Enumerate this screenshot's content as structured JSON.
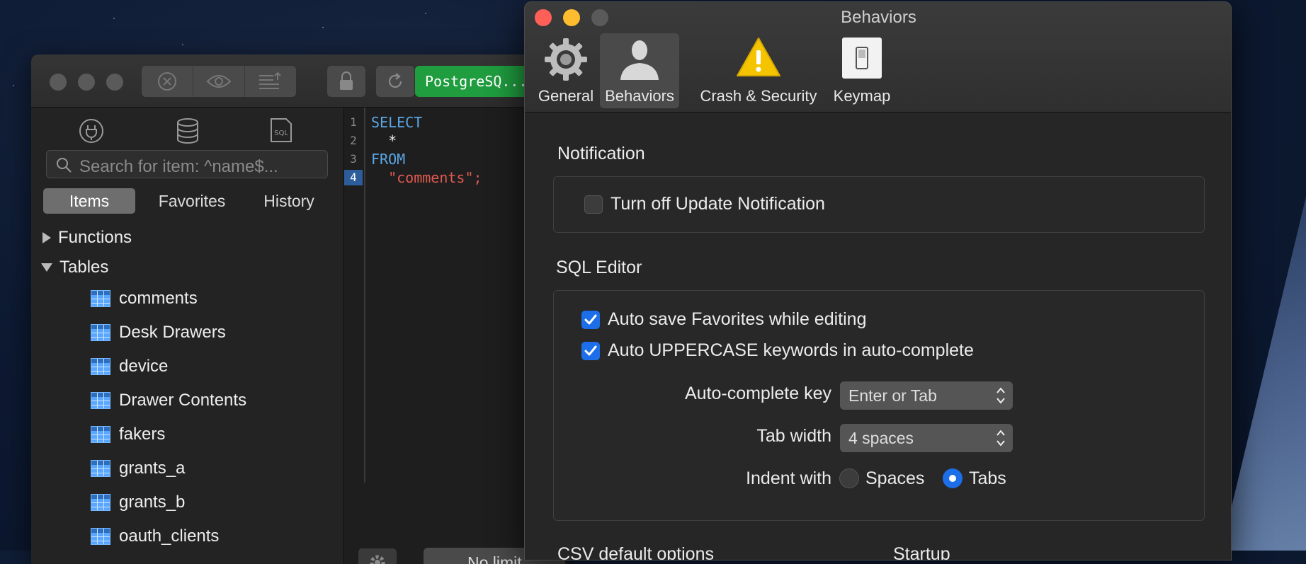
{
  "app": {
    "connection_badge": "PostgreSQ...",
    "search": {
      "placeholder": "Search for item: ^name$..."
    },
    "sidebar_tabs": [
      "Items",
      "Favorites",
      "History"
    ],
    "tree": {
      "functions_label": "Functions",
      "tables_label": "Tables",
      "tables": [
        "comments",
        "Desk Drawers",
        "device",
        "Drawer Contents",
        "fakers",
        "grants_a",
        "grants_b",
        "oauth_clients"
      ]
    },
    "editor": {
      "line_numbers": [
        "1",
        "2",
        "3",
        "4"
      ],
      "lines": [
        "SELECT",
        "  *",
        "FROM",
        "  \"comments\";"
      ],
      "no_limit_label": "No limit"
    }
  },
  "prefs": {
    "title": "Behaviors",
    "tabs": [
      {
        "label": "General",
        "icon": "gear-icon"
      },
      {
        "label": "Behaviors",
        "icon": "person-icon",
        "selected": true
      },
      {
        "label": "Crash & Security",
        "icon": "warning-icon"
      },
      {
        "label": "Keymap",
        "icon": "switch-icon"
      }
    ],
    "notification": {
      "title": "Notification",
      "turn_off_update": {
        "label": "Turn off Update Notification",
        "checked": false
      }
    },
    "sql_editor": {
      "title": "SQL Editor",
      "auto_save_favorites": {
        "label": "Auto save Favorites while editing",
        "checked": true
      },
      "auto_uppercase": {
        "label": "Auto UPPERCASE keywords in auto-complete",
        "checked": true
      },
      "autocomplete_key": {
        "label": "Auto-complete key",
        "value": "Enter or Tab"
      },
      "tab_width": {
        "label": "Tab width",
        "value": "4 spaces"
      },
      "indent_with": {
        "label": "Indent with",
        "options": [
          "Spaces",
          "Tabs"
        ],
        "selected": "Tabs"
      }
    },
    "csv_title": "CSV default options",
    "startup_title": "Startup"
  },
  "colors": {
    "accent_blue": "#1c6fe8",
    "badge_green": "#1f9d3f",
    "keyword": "#5aa7e6",
    "string": "#e05a4f"
  }
}
